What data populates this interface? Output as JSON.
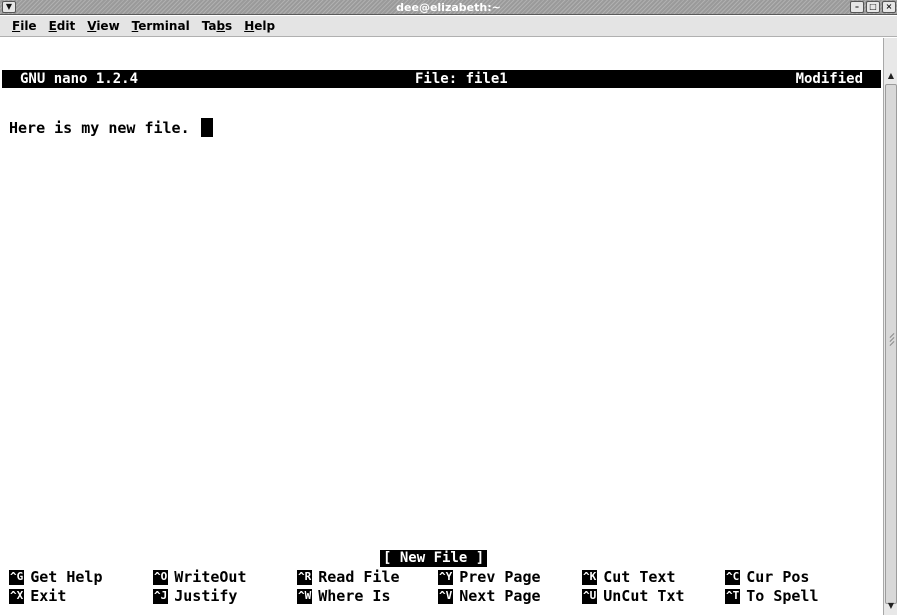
{
  "window": {
    "title": "dee@elizabeth:~",
    "menu_icon": "chevron-down-icon",
    "minimize_icon": "minimize-icon",
    "maximize_icon": "maximize-icon",
    "close_icon": "close-icon"
  },
  "menubar": {
    "items": [
      {
        "label_pre": "",
        "mnemonic": "F",
        "label_post": "ile"
      },
      {
        "label_pre": "",
        "mnemonic": "E",
        "label_post": "dit"
      },
      {
        "label_pre": "",
        "mnemonic": "V",
        "label_post": "iew"
      },
      {
        "label_pre": "",
        "mnemonic": "T",
        "label_post": "erminal"
      },
      {
        "label_pre": "Ta",
        "mnemonic": "b",
        "label_post": "s"
      },
      {
        "label_pre": "",
        "mnemonic": "H",
        "label_post": "elp"
      }
    ]
  },
  "nano": {
    "header": {
      "version": "GNU nano 1.2.4",
      "file": "File: file1",
      "state": "Modified"
    },
    "content": "Here is my new file. ",
    "status_message": "[ New File ]",
    "shortcuts_row1": [
      {
        "key": "^G",
        "label": "Get Help"
      },
      {
        "key": "^O",
        "label": "WriteOut"
      },
      {
        "key": "^R",
        "label": "Read File"
      },
      {
        "key": "^Y",
        "label": "Prev Page"
      },
      {
        "key": "^K",
        "label": "Cut Text"
      },
      {
        "key": "^C",
        "label": "Cur Pos"
      }
    ],
    "shortcuts_row2": [
      {
        "key": "^X",
        "label": "Exit"
      },
      {
        "key": "^J",
        "label": "Justify"
      },
      {
        "key": "^W",
        "label": "Where Is"
      },
      {
        "key": "^V",
        "label": "Next Page"
      },
      {
        "key": "^U",
        "label": "UnCut Txt"
      },
      {
        "key": "^T",
        "label": "To Spell"
      }
    ]
  },
  "colors": {
    "titlebar": "#9a9a9a",
    "menubar": "#e4e4e4",
    "terminal_bg": "#ffffff",
    "terminal_fg": "#000000"
  }
}
